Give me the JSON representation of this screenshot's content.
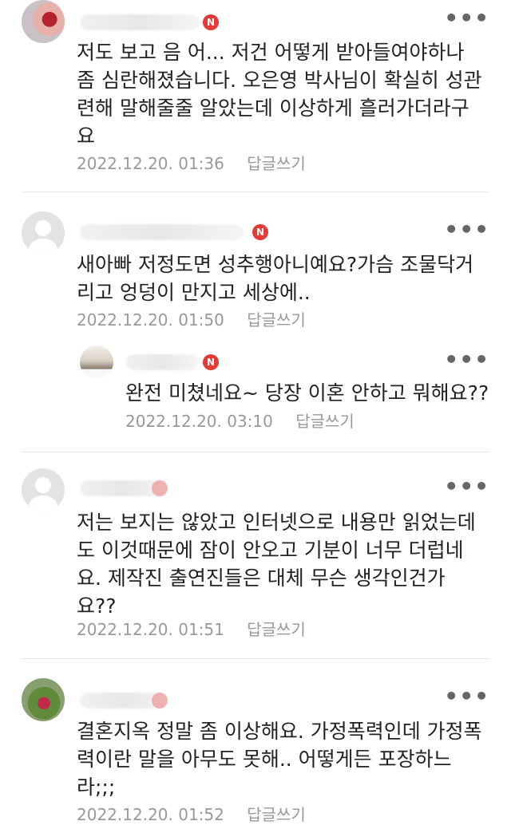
{
  "comments": [
    {
      "text": "저도 보고 음 어... 저건 어떻게 받아들여야하나\n좀 심란해졌습니다. 오은영 박사님이 확실히 성관\n련해 말해줄줄 알았는데 이상하게 흘러가더라구\n요",
      "time": "2022.12.20. 01:36",
      "reply_label": "답글쓰기",
      "badge": "N"
    },
    {
      "text": "새아빠 저정도면 성추행아니예요?가슴 조물닥거\n리고 엉덩이 만지고 세상에..",
      "time": "2022.12.20. 01:50",
      "reply_label": "답글쓰기",
      "badge": "N"
    },
    {
      "text": "완전 미쳤네요~ 당장 이혼 안하고 뭐해요??",
      "time": "2022.12.20. 03:10",
      "reply_label": "답글쓰기",
      "badge": "N"
    },
    {
      "text": "저는 보지는 않았고 인터넷으로 내용만 읽었는데\n도 이것때문에 잠이 안오고 기분이 너무 더럽네\n요. 제작진 출연진들은 대체 무슨 생각인건가\n요??",
      "time": "2022.12.20. 01:51",
      "reply_label": "답글쓰기"
    },
    {
      "text": "결혼지옥 정말 좀 이상해요. 가정폭력인데 가정폭\n력이란 말을 아무도 못해.. 어떻게든 포장하느\n라;;;",
      "time": "2022.12.20. 01:52",
      "reply_label": "답글쓰기"
    }
  ],
  "more_icon": "more-options-icon",
  "accent": "#e53935"
}
